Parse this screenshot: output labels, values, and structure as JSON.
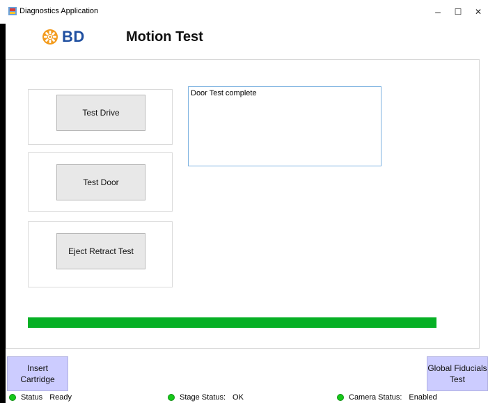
{
  "window": {
    "title": "Diagnostics Application",
    "minimize": "–",
    "maximize": "☐",
    "close": "✕"
  },
  "header": {
    "logo_text": "BD",
    "page_title": "Motion Test"
  },
  "tests": {
    "drive_label": "Test Drive",
    "door_label": "Test Door",
    "eject_label": "Eject Retract Test"
  },
  "log": {
    "text": "Door Test complete"
  },
  "progress": {
    "value_fraction": 1.0
  },
  "side_buttons": {
    "insert_cartridge": "Insert Cartridge",
    "global_fiducials": "Global Fiducials Test"
  },
  "status": {
    "status_label": "Status",
    "status_value": "Ready",
    "stage_label": "Stage Status:",
    "stage_value": "OK",
    "camera_label": "Camera Status:",
    "camera_value": "Enabled"
  },
  "colors": {
    "progress_green": "#06b025",
    "side_button_bg": "#ccccff",
    "status_dot": "#16c91a",
    "bd_orange": "#f39c1f",
    "bd_blue": "#1f4fa0"
  },
  "icons": {
    "app": "app-icon",
    "logo": "bd-logo-icon"
  }
}
